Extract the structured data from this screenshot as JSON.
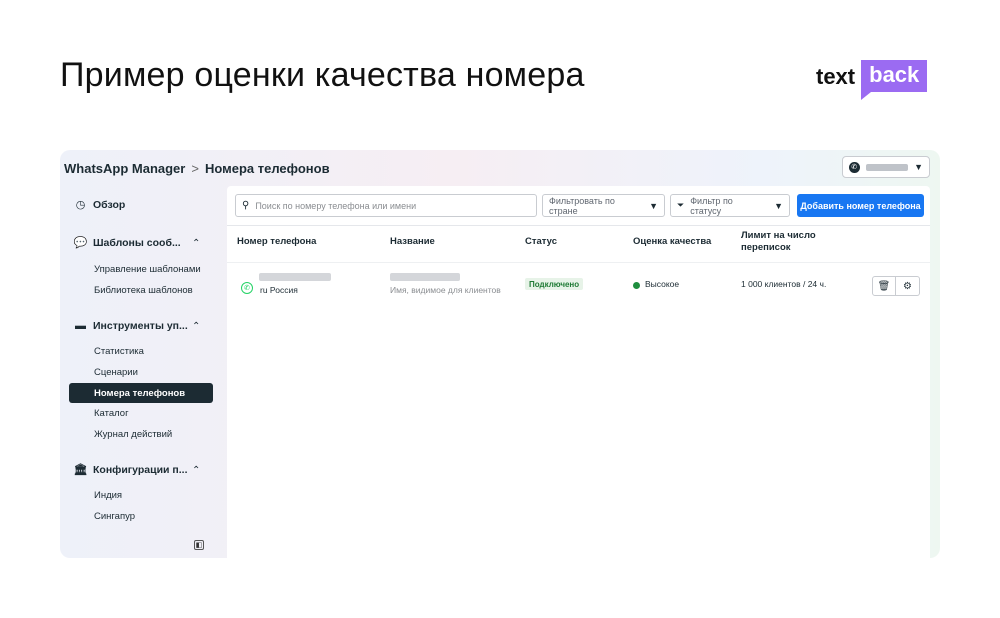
{
  "slide": {
    "title": "Пример оценки качества номера"
  },
  "brand": {
    "text": "text",
    "back": "back",
    "accent": "#9b6bf2"
  },
  "topbar": {
    "root": "WhatsApp Manager",
    "separator": ">",
    "page": "Номера телефонов",
    "account_icon": "whatsapp-icon"
  },
  "sidebar": {
    "overview": "Обзор",
    "templates": {
      "label": "Шаблоны сооб...",
      "items": [
        "Управление шаблонами",
        "Библиотека шаблонов"
      ]
    },
    "tools": {
      "label": "Инструменты уп...",
      "items": [
        "Статистика",
        "Сценарии",
        "Номера телефонов",
        "Каталог",
        "Журнал действий"
      ],
      "active": "Номера телефонов"
    },
    "config": {
      "label": "Конфигурации п...",
      "items": [
        "Индия",
        "Сингапур"
      ]
    }
  },
  "toolbar": {
    "search_placeholder": "Поиск по номеру телефона или имени",
    "country_filter": "Фильтровать по стране",
    "status_filter": "Фильтр по статусу",
    "add_button": "Добавить номер телефона",
    "accent": "#1877f2"
  },
  "table": {
    "headers": {
      "phone": "Номер телефона",
      "name": "Название",
      "status": "Статус",
      "quality": "Оценка качества",
      "limit": "Лимит на число переписок"
    },
    "rows": [
      {
        "country": "ru Россия",
        "name_hint": "Имя, видимое для клиентов",
        "status": "Подключено",
        "quality": "Высокое",
        "quality_color": "#1e8e3e",
        "limit": "1 000 клиентов / 24 ч."
      }
    ]
  }
}
